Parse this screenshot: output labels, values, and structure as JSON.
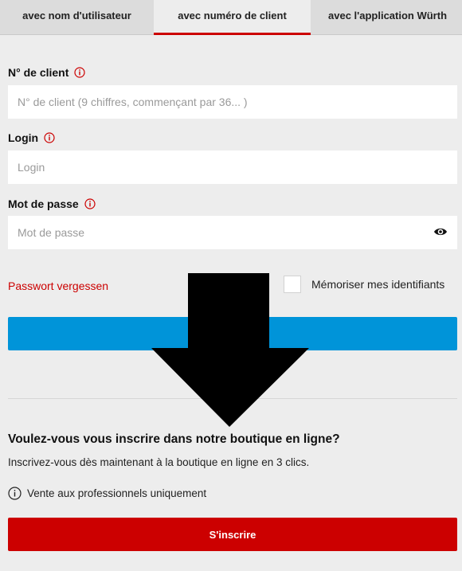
{
  "tabs": [
    {
      "label": "avec nom d'utilisateur"
    },
    {
      "label": "avec numéro de client"
    },
    {
      "label": "avec l'application Würth"
    }
  ],
  "form": {
    "client_number": {
      "label": "N° de client",
      "placeholder": "N° de client (9 chiffres, commençant par 36... )"
    },
    "login": {
      "label": "Login",
      "placeholder": "Login"
    },
    "password": {
      "label": "Mot de passe",
      "placeholder": "Mot de passe"
    },
    "forgot_password": "Passwort vergessen",
    "remember_me": "Mémoriser mes identifiants",
    "login_button_label": ""
  },
  "registration": {
    "title": "Voulez-vous vous inscrire dans notre boutique en ligne?",
    "subtitle": "Inscrivez-vous dès maintenant à la boutique en ligne en 3 clics.",
    "note": "Vente aux professionnels uniquement",
    "button_label": "S'inscrire"
  },
  "colors": {
    "accent_red": "#cc0000",
    "login_blue": "#0094d9",
    "background": "#ededed"
  },
  "icons": [
    "info-icon",
    "eye-icon",
    "down-arrow-overlay"
  ]
}
